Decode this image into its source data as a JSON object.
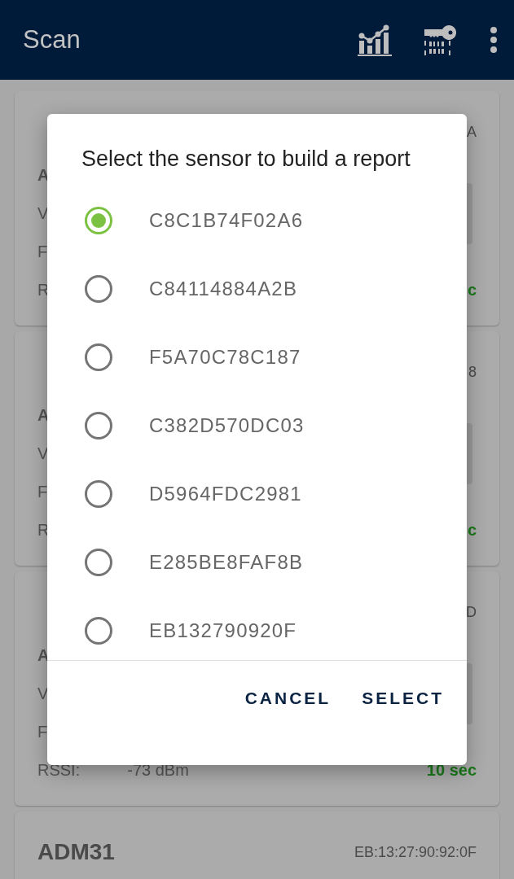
{
  "app_bar": {
    "title": "Scan"
  },
  "cards": [
    {
      "address": "A",
      "lines": [
        {
          "label": "A"
        },
        {
          "label": "V"
        },
        {
          "label": "F"
        },
        {
          "label": "R"
        }
      ],
      "age": "c",
      "has_button": true
    },
    {
      "address": "8",
      "lines": [
        {
          "label": "A"
        },
        {
          "label": "V"
        },
        {
          "label": "F"
        },
        {
          "label": "R"
        }
      ],
      "age": "c",
      "has_button": true
    },
    {
      "address": "D",
      "lines": [
        {
          "label": "A"
        },
        {
          "label": "V"
        },
        {
          "label": "F"
        },
        {
          "label": "RSSI:",
          "value": "-73 dBm"
        }
      ],
      "age": "10 sec",
      "has_button": true
    },
    {
      "title": "ADM31",
      "address": "EB:13:27:90:92:0F",
      "has_button": false
    }
  ],
  "dialog": {
    "title": "Select the sensor to build a report",
    "options": [
      {
        "label": "C8C1B74F02A6",
        "selected": true
      },
      {
        "label": "C84114884A2B",
        "selected": false
      },
      {
        "label": "F5A70C78C187",
        "selected": false
      },
      {
        "label": "C382D570DC03",
        "selected": false
      },
      {
        "label": "D5964FDC2981",
        "selected": false
      },
      {
        "label": "E285BE8FAF8B",
        "selected": false
      },
      {
        "label": "EB132790920F",
        "selected": false
      }
    ],
    "buttons": [
      "CANCEL",
      "SELECT"
    ]
  }
}
